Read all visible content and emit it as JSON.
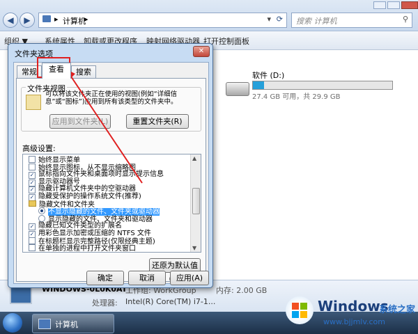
{
  "explorer": {
    "address": "计算机",
    "search_placeholder": "搜索 计算机",
    "toolbar": [
      "组织 ▼",
      "系统属性",
      "卸载或更改程序",
      "映射网络驱动器",
      "打开控制面板"
    ],
    "drive": {
      "name": "软件 (D:)",
      "space": "27.4 GB 可用，共 29.9 GB",
      "used_fraction": 0.08
    },
    "details": {
      "computer_name": "WINDOWS-0L0K0AT",
      "workgroup": "工作组: WorkGroup",
      "memory": "内存: 2.00 GB",
      "processor_label": "处理器:",
      "processor": "Intel(R) Core(TM) i7-1..."
    },
    "taskbar_item": "计算机"
  },
  "dialog": {
    "title": "文件夹选项",
    "tabs": [
      "常规",
      "查看",
      "搜索"
    ],
    "folder_view": {
      "group_title": "文件夹视图",
      "description": "可以将该文件夹正在使用的视图(例如“详细信息”或“图标”)应用到所有该类型的文件夹中。",
      "apply_button": "应用到文件夹(L)",
      "reset_button": "重置文件夹(R)"
    },
    "advanced": {
      "label": "高级设置:",
      "items": [
        {
          "text": "始终显示菜单",
          "kind": "checkbox",
          "checked": false
        },
        {
          "text": "始终显示图标，从不显示缩略图",
          "kind": "checkbox",
          "checked": false
        },
        {
          "text": "鼠标指向文件夹和桌面项时显示提示信息",
          "kind": "checkbox",
          "checked": true
        },
        {
          "text": "显示驱动器号",
          "kind": "checkbox",
          "checked": true
        },
        {
          "text": "隐藏计算机文件夹中的空驱动器",
          "kind": "checkbox",
          "checked": true
        },
        {
          "text": "隐藏受保护的操作系统文件(推荐)",
          "kind": "checkbox",
          "checked": true
        },
        {
          "text": "隐藏文件和文件夹",
          "kind": "folder",
          "checked": false
        },
        {
          "text": "不显示隐藏的文件、文件夹或驱动器",
          "kind": "radio",
          "checked": true
        },
        {
          "text": "显示隐藏的文件、文件夹和驱动器",
          "kind": "radio",
          "checked": false
        },
        {
          "text": "隐藏已知文件类型的扩展名",
          "kind": "checkbox",
          "checked": true
        },
        {
          "text": "用彩色显示加密或压缩的 NTFS 文件",
          "kind": "checkbox",
          "checked": true
        },
        {
          "text": "在标题栏显示完整路径(仅限经典主题)",
          "kind": "checkbox",
          "checked": false
        },
        {
          "text": "在单独的进程中打开文件夹窗口",
          "kind": "checkbox",
          "checked": false
        }
      ]
    },
    "restore_defaults": "还原为默认值(D)",
    "ok": "确定",
    "cancel": "取消",
    "apply": "应用(A)"
  },
  "watermark": {
    "brand": "Windows",
    "suffix": "系统之家",
    "url": "www.bjjmlv.com"
  },
  "colors": {
    "highlight": "#3399ff",
    "annotation_red": "#e02020",
    "drive_bar": "#26a0da"
  }
}
